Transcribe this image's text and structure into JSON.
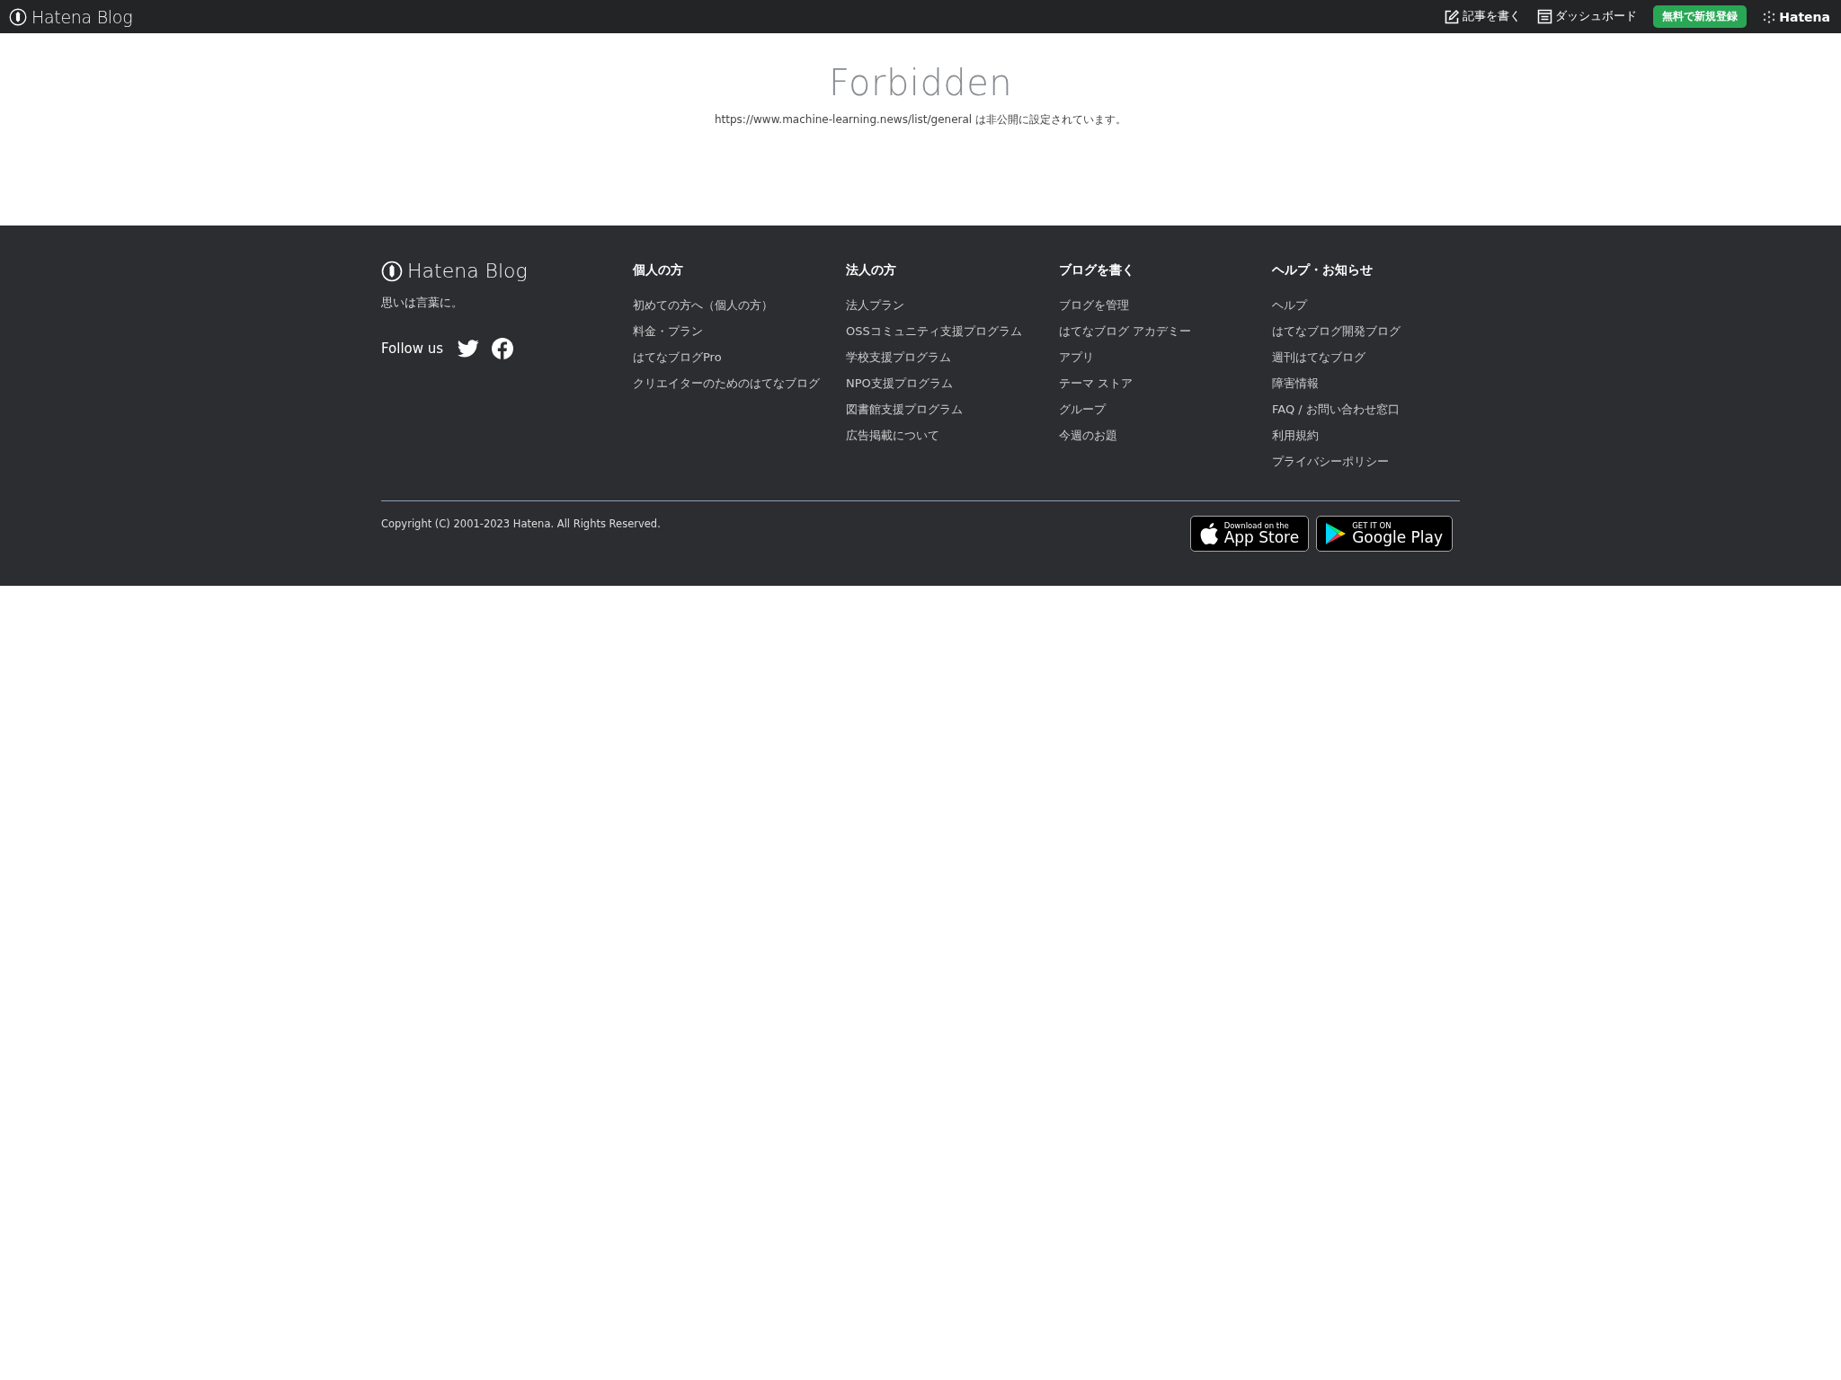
{
  "top_bar": {
    "logo": "Hatena Blog",
    "links": [
      {
        "kind": "write",
        "label": "記事を書く"
      },
      {
        "kind": "dashboard",
        "label": "ダッシュボード"
      }
    ],
    "signup_button": "無料で新規登録",
    "brand": "Hatena"
  },
  "main": {
    "title": "Forbidden",
    "message": "https://www.machine-learning.news/list/general は非公開に設定されています。"
  },
  "footer": {
    "logo": "Hatena Blog",
    "tagline": "思いは言葉に。",
    "follow_label": "Follow us",
    "social": [
      {
        "kind": "twitter"
      },
      {
        "kind": "facebook"
      }
    ],
    "columns": [
      {
        "heading": "個人の方",
        "links": [
          "初めての方へ（個人の方）",
          "料金・プラン",
          "はてなブログPro",
          "クリエイターのためのはてなブログ"
        ]
      },
      {
        "heading": "法人の方",
        "links": [
          "法人プラン",
          "OSSコミュニティ支援プログラム",
          "学校支援プログラム",
          "NPO支援プログラム",
          "図書館支援プログラム",
          "広告掲載について"
        ]
      },
      {
        "heading": "ブログを書く",
        "links": [
          "ブログを管理",
          "はてなブログ アカデミー",
          "アプリ",
          "テーマ ストア",
          "グループ",
          "今週のお題"
        ]
      },
      {
        "heading": "ヘルプ・お知らせ",
        "links": [
          "ヘルプ",
          "はてなブログ開発ブログ",
          "週刊はてなブログ",
          "障害情報",
          "FAQ / お問い合わせ窓口",
          "利用規約",
          "プライバシーポリシー"
        ]
      }
    ],
    "copyright": "Copyright (C) 2001-2023 Hatena. All Rights Reserved.",
    "badges": [
      {
        "kind": "apple",
        "small": "Download on the",
        "large": "App Store"
      },
      {
        "kind": "google",
        "small": "GET IT ON",
        "large": "Google Play"
      }
    ]
  }
}
